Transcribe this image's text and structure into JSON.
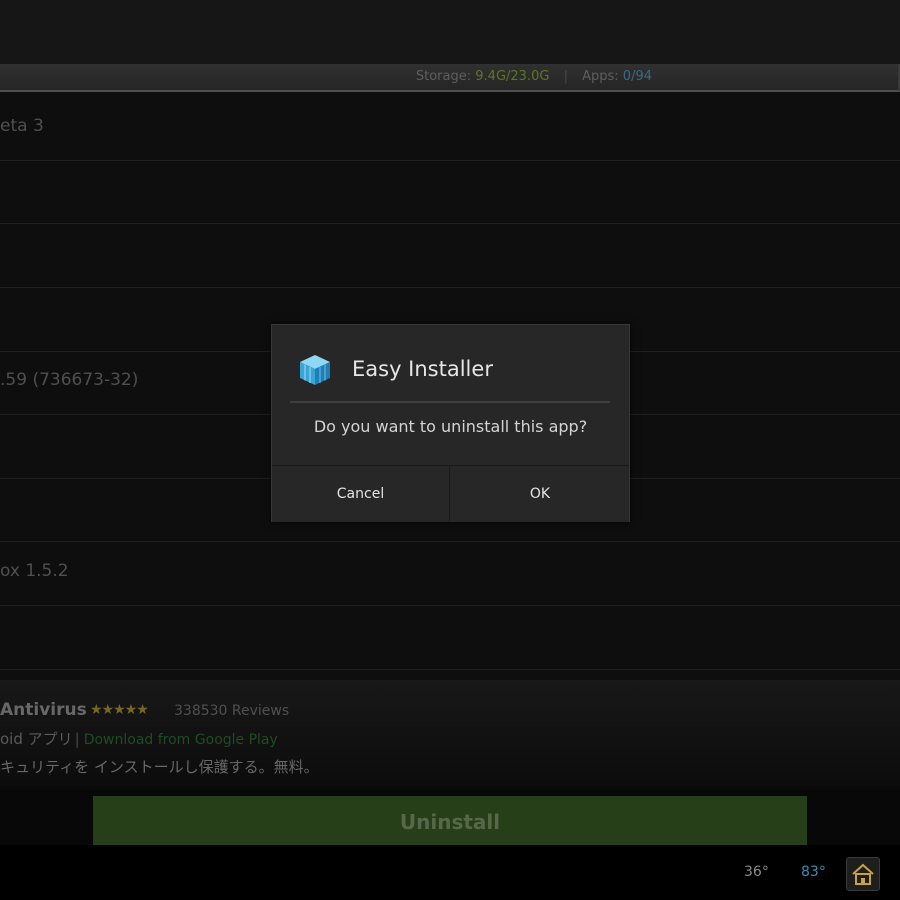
{
  "storage": {
    "label": "Storage:",
    "value": "9.4G/23.0G",
    "separator": "|",
    "apps_label": "Apps:",
    "apps_value": "0/94"
  },
  "list_rows": [
    {
      "text": "eta 3"
    },
    {
      "text": ""
    },
    {
      "text": ""
    },
    {
      "text": ""
    },
    {
      "text": ".59 (736673-32)"
    },
    {
      "text": ""
    },
    {
      "text": ""
    },
    {
      "text": "ox 1.5.2"
    },
    {
      "text": ""
    }
  ],
  "app_details": {
    "name": "Antivirus",
    "stars": "★★★★★",
    "reviews": "338530 Reviews",
    "platform": "oid アプリ",
    "pipe": "|",
    "download_link": "Download from Google Play",
    "description": "キュリティを インストールし保護する。無料。"
  },
  "uninstall_button": "Uninstall",
  "dialog": {
    "title": "Easy Installer",
    "message": "Do you want to uninstall this app?",
    "cancel": "Cancel",
    "ok": "OK",
    "icon": "cube-icon"
  },
  "navbar": {
    "temp1": "36°",
    "temp2": "83°",
    "home_icon": "home-icon"
  },
  "colors": {
    "uninstall_bg": "#2e4a1d",
    "dialog_bg": "#272727",
    "link_green": "#245a2a",
    "accent_blue": "#3a8fb5"
  }
}
